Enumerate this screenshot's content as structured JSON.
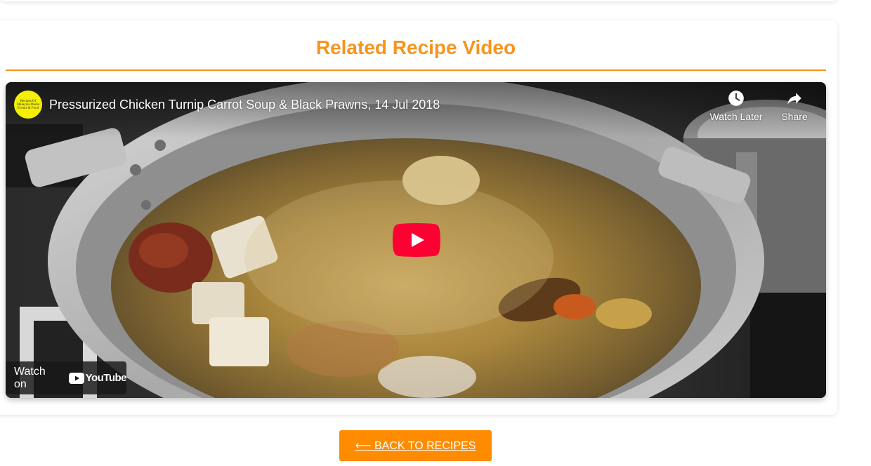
{
  "section": {
    "title": "Related Recipe Video"
  },
  "video": {
    "title": "Pressurized Chicken Turnip Carrot Soup & Black Prawns, 14 Jul 2018",
    "channel_avatar_text": "Recipes Of Malaysia Media Events & Food",
    "watch_later_label": "Watch Later",
    "share_label": "Share",
    "watch_on_label": "Watch on",
    "youtube_word": "YouTube"
  },
  "nav": {
    "back_label": "⟵ BACK TO RECIPES"
  },
  "colors": {
    "accent": "#f7941d",
    "button": "#ff8c00",
    "play_red": "#ff0033"
  },
  "icons": [
    "clock-icon",
    "share-arrow-icon",
    "play-icon",
    "youtube-logo-icon"
  ]
}
